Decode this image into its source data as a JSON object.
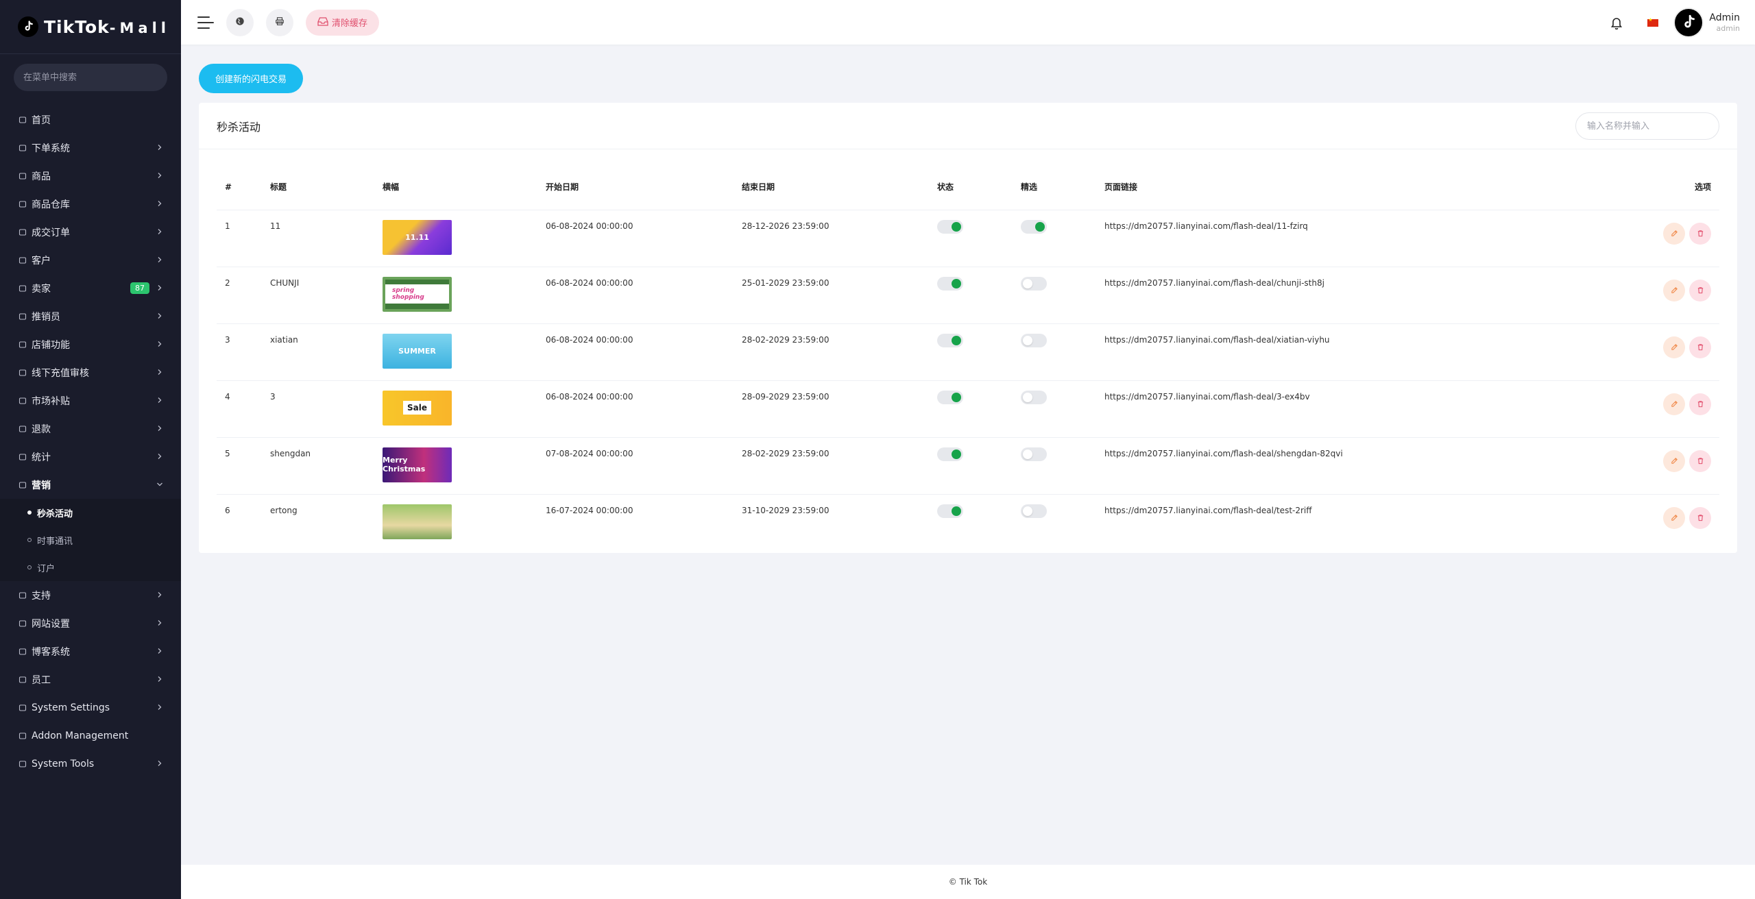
{
  "brand": {
    "name": "TikTok",
    "suffix": "-Mall"
  },
  "sidebar": {
    "search_placeholder": "在菜单中搜索",
    "items": [
      {
        "label": "首页",
        "icon": "home-icon"
      },
      {
        "label": "下单系统",
        "icon": "list-icon"
      },
      {
        "label": "商品",
        "icon": "bag-icon"
      },
      {
        "label": "商品仓库",
        "icon": "warehouse-icon"
      },
      {
        "label": "成交订单",
        "icon": "orders-icon"
      },
      {
        "label": "客户",
        "icon": "users-icon"
      },
      {
        "label": "卖家",
        "icon": "user-icon",
        "badge": "87"
      },
      {
        "label": "推销员",
        "icon": "user-icon"
      },
      {
        "label": "店铺功能",
        "icon": "user-icon"
      },
      {
        "label": "线下充值审核",
        "icon": "recharge-icon"
      },
      {
        "label": "市场补贴",
        "icon": "link-icon"
      },
      {
        "label": "退款",
        "icon": "refund-icon"
      },
      {
        "label": "统计",
        "icon": "stats-icon"
      },
      {
        "label": "营销",
        "icon": "megaphone-icon"
      }
    ],
    "marketing_sub": [
      "秒杀活动",
      "时事通讯",
      "订户"
    ],
    "items_after": [
      {
        "label": "支持",
        "icon": "link-icon"
      },
      {
        "label": "网站设置",
        "icon": "monitor-icon"
      },
      {
        "label": "博客系统",
        "icon": "blog-icon"
      },
      {
        "label": "员工",
        "icon": "staff-icon"
      },
      {
        "label": "System Settings",
        "icon": "settings-icon"
      },
      {
        "label": "Addon Management",
        "icon": "addon-icon"
      },
      {
        "label": "System Tools",
        "icon": "tools-icon"
      }
    ]
  },
  "topbar": {
    "clear_cache": "清除缓存",
    "user_name": "Admin",
    "user_role": "admin"
  },
  "main": {
    "create_button": "创建新的闪电交易",
    "card_title": "秒杀活动",
    "search_placeholder": "输入名称并输入",
    "columns": [
      "#",
      "标题",
      "横幅",
      "开始日期",
      "结束日期",
      "状态",
      "精选",
      "页面链接",
      "选项"
    ],
    "rows": [
      {
        "num": "1",
        "title": "11",
        "banner_text": "11.11",
        "start": "06-08-2024 00:00:00",
        "end": "28-12-2026 23:59:00",
        "status": true,
        "featured": true,
        "link": "https://dm20757.lianyinai.com/flash-deal/11-fzirq"
      },
      {
        "num": "2",
        "title": "CHUNJI",
        "banner_text": "spring shopping",
        "start": "06-08-2024 00:00:00",
        "end": "25-01-2029 23:59:00",
        "status": true,
        "featured": false,
        "link": "https://dm20757.lianyinai.com/flash-deal/chunji-sth8j"
      },
      {
        "num": "3",
        "title": "xiatian",
        "banner_text": "SUMMER",
        "start": "06-08-2024 00:00:00",
        "end": "28-02-2029 23:59:00",
        "status": true,
        "featured": false,
        "link": "https://dm20757.lianyinai.com/flash-deal/xiatian-viyhu"
      },
      {
        "num": "4",
        "title": "3",
        "banner_text": "Sale",
        "start": "06-08-2024 00:00:00",
        "end": "28-09-2029 23:59:00",
        "status": true,
        "featured": false,
        "link": "https://dm20757.lianyinai.com/flash-deal/3-ex4bv"
      },
      {
        "num": "5",
        "title": "shengdan",
        "banner_text": "Merry Christmas",
        "start": "07-08-2024 00:00:00",
        "end": "28-02-2029 23:59:00",
        "status": true,
        "featured": false,
        "link": "https://dm20757.lianyinai.com/flash-deal/shengdan-82qvi"
      },
      {
        "num": "6",
        "title": "ertong",
        "banner_text": "",
        "start": "16-07-2024 00:00:00",
        "end": "31-10-2029 23:59:00",
        "status": true,
        "featured": false,
        "link": "https://dm20757.lianyinai.com/flash-deal/test-2riff"
      }
    ]
  },
  "footer": {
    "text": "© Tik Tok"
  },
  "colors": {
    "sidebar_bg": "#1a1c2b",
    "accent": "#1cbcf0",
    "toggle_on": "#17a34a",
    "badge": "#2cc46e"
  }
}
